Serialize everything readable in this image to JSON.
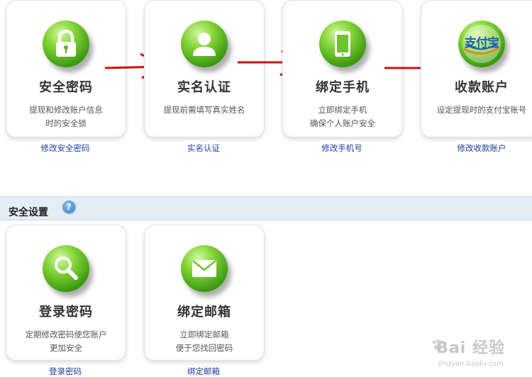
{
  "steps": [
    {
      "title": "安全密码",
      "desc_line1": "提现和修改账户信息",
      "desc_line2": "时的安全锁",
      "link": "修改安全密码",
      "icon": "lock-icon"
    },
    {
      "title": "实名认证",
      "desc_line1": "提现前需填写真实姓名",
      "desc_line2": "",
      "link": "实名认证",
      "icon": "user-icon"
    },
    {
      "title": "绑定手机",
      "desc_line1": "立即绑定手机",
      "desc_line2": "确保个人账户安全",
      "link": "修改手机号",
      "icon": "phone-icon"
    },
    {
      "title": "收款账户",
      "desc_line1": "设定提现时的支付宝账号",
      "desc_line2": "",
      "link": "修改收款账户",
      "icon": "alipay-icon",
      "logo_text": "支付宝"
    }
  ],
  "security": {
    "section_title": "安全设置",
    "help_glyph": "?",
    "items": [
      {
        "title": "登录密码",
        "desc_line1": "定期修改密码使您账户",
        "desc_line2": "更加安全",
        "link": "登录密码",
        "icon": "magnifier-icon"
      },
      {
        "title": "绑定邮箱",
        "desc_line1": "立即绑定邮箱",
        "desc_line2": "便于您找回密码",
        "link": "绑定邮箱",
        "icon": "mail-icon"
      }
    ]
  },
  "watermark": {
    "brand": "Bai 经验",
    "url": "jingyan.baidu.com"
  },
  "colors": {
    "icon_green": "#4fae1b",
    "link_blue": "#1d3e9b",
    "arrow_red": "#cc1111",
    "section_bg": "#e4eef7"
  }
}
